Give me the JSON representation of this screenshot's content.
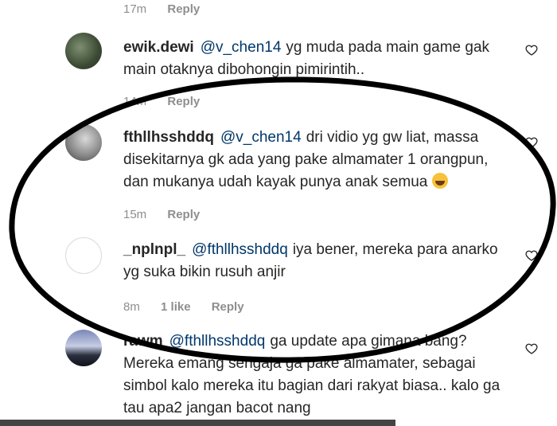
{
  "top_meta": {
    "time": "17m",
    "reply": "Reply"
  },
  "comments": [
    {
      "username": "ewik.dewi",
      "mention": "@v_chen14",
      "text": "yg muda pada main game gak main otaknya dibohongin pimirintih..",
      "time": "14m",
      "reply": "Reply"
    },
    {
      "username": "fthllhsshddq",
      "mention": "@v_chen14",
      "text": "dri vidio yg gw liat, massa disekitarnya gk ada yang pake almamater 1 orangpun, dan mukanya udah kayak punya anak semua",
      "emoji": "laughing-emoji",
      "time": "15m",
      "reply": "Reply"
    },
    {
      "username": "_nplnpl_",
      "mention": "@fthllhsshddq",
      "text": "iya bener, mereka para anarko yg suka bikin rusuh anjir",
      "time": "8m",
      "likes": "1 like",
      "reply": "Reply"
    },
    {
      "username": "rawm",
      "mention": "@fthllhsshddq",
      "text": "ga update apa gimana bang? Mereka emang sengaja ga pake almamater, sebagai simbol kalo mereka itu bagian dari rakyat biasa.. kalo ga tau apa2 jangan bacot nang"
    }
  ],
  "colors": {
    "mention": "#00376b",
    "meta": "#8e8e8e",
    "annotation": "#000000"
  }
}
